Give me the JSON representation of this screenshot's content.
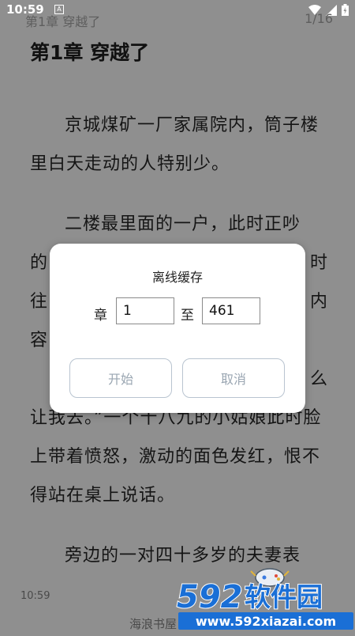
{
  "status_bar": {
    "time": "10:59",
    "notification_badge": "A"
  },
  "header": {
    "chapter": "第1章 穿越了",
    "page": "1/16"
  },
  "chapter_title": "第1章 穿越了",
  "paragraphs": [
    "京城煤矿一厂家属院内，筒子楼里白天走动的人特别少。",
    "二楼最里面的一户，此时正吵",
    "的",
    "时",
    "往",
    "内",
    "容",
    "么",
    "让我去。”一个十八九的小姑娘此时脸上带着愤怒，激动的面色发红，恨不得站在桌上说话。",
    "旁边的一对四十多岁的夫妻表"
  ],
  "footer": {
    "time": "10:59",
    "source": "海浪书屋"
  },
  "dialog": {
    "title": "离线缓存",
    "from_label": "章",
    "from_value": "1",
    "to_label": "至",
    "to_value": "461",
    "start_button": "开始",
    "cancel_button": "取消"
  },
  "watermark": {
    "brand": "592软件园",
    "url": "www.592xiazai.com"
  },
  "colors": {
    "page_bg": "#8f8f8f",
    "dialog_bg": "#ffffff",
    "button_text": "#9aa6b2",
    "watermark_blue": "#1a6fd6"
  }
}
